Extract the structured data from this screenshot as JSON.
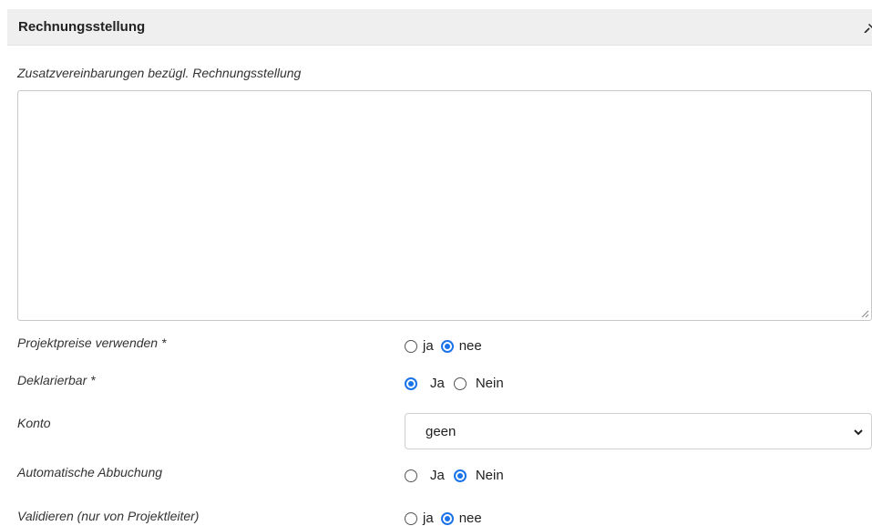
{
  "section": {
    "title": "Rechnungsstellung"
  },
  "notes": {
    "label": "Zusatzvereinbarungen bezügl. Rechnungsstellung",
    "value": ""
  },
  "fields": {
    "projektpreise": {
      "label": "Projektpreise verwenden *",
      "options": [
        "ja",
        "nee"
      ],
      "selected": "nee"
    },
    "deklarierbar": {
      "label": "Deklarierbar *",
      "options": [
        "Ja",
        "Nein"
      ],
      "selected": "Ja"
    },
    "konto": {
      "label": "Konto",
      "value": "geen"
    },
    "automatische_abbuchung": {
      "label": "Automatische Abbuchung",
      "options": [
        "Ja",
        "Nein"
      ],
      "selected": "Nein"
    },
    "validieren": {
      "label": "Validieren (nur von Projektleiter)",
      "options": [
        "ja",
        "nee"
      ],
      "selected": "nee"
    }
  },
  "colors": {
    "accent": "#1a73e8",
    "header_bg": "#efefef"
  }
}
